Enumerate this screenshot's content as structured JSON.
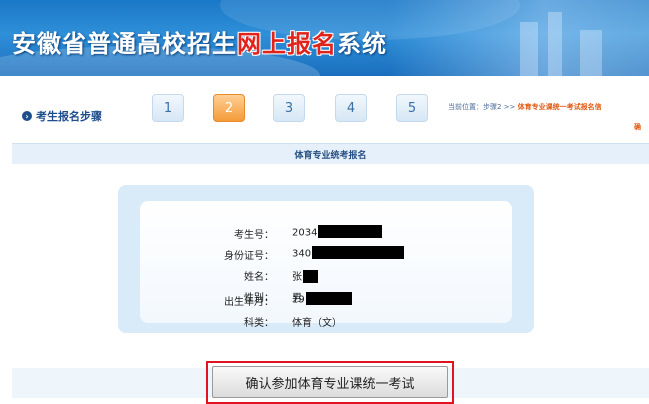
{
  "header": {
    "title_prefix": "安徽省普通高校招生",
    "title_highlight": "网上报名",
    "title_suffix": "系统"
  },
  "steps": {
    "label": "考生报名步骤",
    "items": [
      "1",
      "2",
      "3",
      "4",
      "5"
    ],
    "active_index": 1
  },
  "breadcrumb": {
    "prefix": "当前位置：步骤2 >> ",
    "current": "体育专业课统一考试报名信",
    "current_cont": "确"
  },
  "section": {
    "title": "体育专业统考报名"
  },
  "info": {
    "exam_no": {
      "label": "考生号：",
      "value": "2034"
    },
    "id_no": {
      "label": "身份证号：",
      "value": "340"
    },
    "name": {
      "label": "姓名：",
      "value": "张"
    },
    "gender": {
      "label": "性别：",
      "value": "男"
    },
    "birth": {
      "label": "出生年月：",
      "value": "19"
    },
    "category": {
      "label": "科类：",
      "value": "体育（文）"
    }
  },
  "actions": {
    "confirm_label": "确认参加体育专业课统一考试"
  },
  "colors": {
    "accent": "#e0241b",
    "active_step": "#f39b3a",
    "header_blue": "#1a78c8"
  }
}
